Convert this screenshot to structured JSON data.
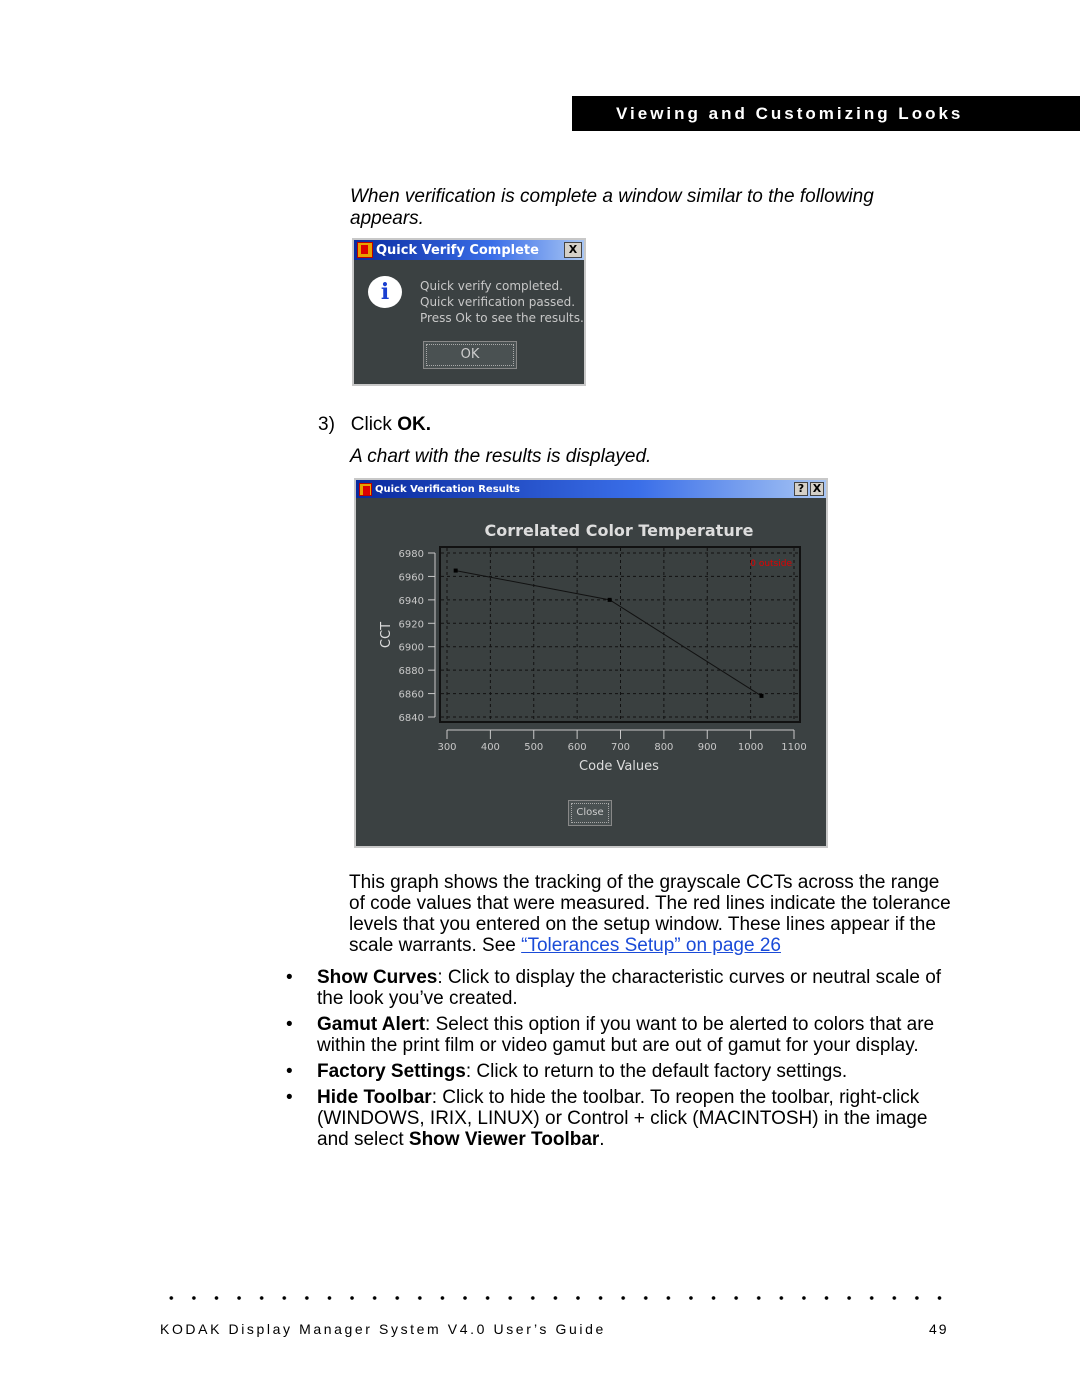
{
  "header": {
    "section_title": "Viewing and Customizing Looks"
  },
  "intro": "When verification is complete a window similar to the following appears.",
  "dialog1": {
    "title": "Quick Verify Complete",
    "icon": "info-icon",
    "lines": [
      "Quick verify completed.",
      "Quick verification passed.",
      "Press Ok to see the results."
    ],
    "ok_label": "OK",
    "close_label": "X"
  },
  "step": {
    "number": "3)",
    "text": "Click ",
    "bold": "OK."
  },
  "result_note": "A chart with the results is displayed.",
  "dialog2": {
    "title": "Quick Verification Results",
    "help_label": "?",
    "close_x": "X",
    "close_label": "Close"
  },
  "chart_data": {
    "type": "line",
    "title": "Correlated Color Temperature",
    "xlabel": "Code Values",
    "ylabel": "CCT",
    "xlim": [
      300,
      1100
    ],
    "ylim": [
      6840,
      6980
    ],
    "x_ticks": [
      "300",
      "400",
      "500",
      "600",
      "700",
      "800",
      "900",
      "1000",
      "1100"
    ],
    "y_ticks": [
      "6980",
      "6960",
      "6940",
      "6920",
      "6900",
      "6880",
      "6860",
      "6840"
    ],
    "grid": true,
    "annotation": "0 outside",
    "annotation_color": "#e00000",
    "x": [
      320,
      675,
      1025
    ],
    "y": [
      6965,
      6940,
      6858
    ]
  },
  "description": {
    "text": "This graph shows the tracking of the grayscale CCTs across the range of code values that were measured. The red lines indicate the tolerance levels that you entered on the setup window. These lines appear if the scale warrants. See ",
    "link": "“Tolerances Setup” on page 26"
  },
  "bullets": [
    {
      "bold": "Show Curves",
      "text": ": Click to display the characteristic curves or neutral scale of the look you’ve created."
    },
    {
      "bold": "Gamut Alert",
      "text": ": Select this option if you want to be alerted to colors that are within the print film or video gamut but are out of gamut for your display."
    },
    {
      "bold": "Factory Settings",
      "text": ": Click to return to the default factory settings."
    },
    {
      "bold": "Hide Toolbar",
      "text": ": Click to hide the toolbar. To reopen the toolbar, right-click (WINDOWS, IRIX, LINUX) or Control + click (MACINTOSH) in the image and select ",
      "bold2": "Show Viewer Toolbar",
      "end": "."
    }
  ],
  "footer": {
    "title": "KODAK Display Manager System V4.0 User’s Guide",
    "page": "49"
  }
}
